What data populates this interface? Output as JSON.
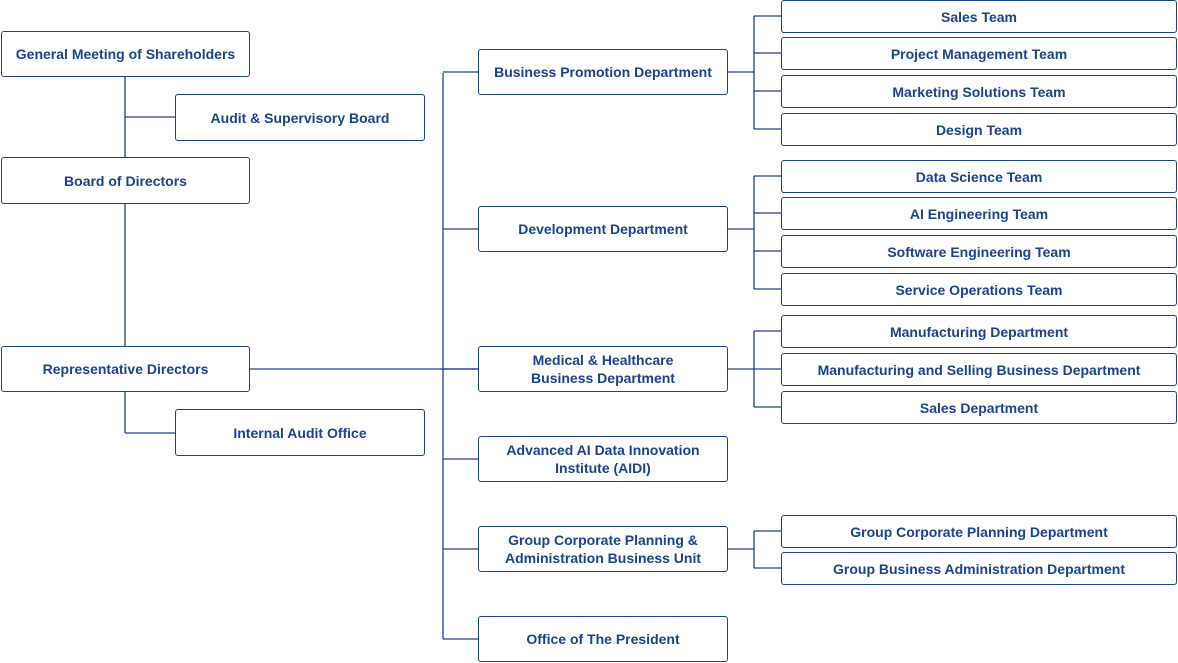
{
  "colors": {
    "line": "#1a4490",
    "text": "#1a4490"
  },
  "left": {
    "shareholders": "General Meeting of Shareholders",
    "audit_board": "Audit & Supervisory Board",
    "board": "Board of Directors",
    "representative": "Representative Directors",
    "internal_audit": "Internal Audit Office"
  },
  "departments": [
    {
      "label": "Business Promotion Department",
      "teams": [
        "Sales Team",
        "Project Management Team",
        "Marketing Solutions Team",
        "Design Team"
      ]
    },
    {
      "label": "Development Department",
      "teams": [
        "Data Science Team",
        "AI Engineering Team",
        "Software Engineering Team",
        "Service Operations Team"
      ]
    },
    {
      "label": "Medical & Healthcare\nBusiness Department",
      "teams": [
        "Manufacturing Department",
        "Manufacturing and Selling Business Department",
        "Sales Department"
      ]
    },
    {
      "label": "Advanced AI Data Innovation\nInstitute (AIDI)",
      "teams": []
    },
    {
      "label": "Group Corporate Planning &\nAdministration Business Unit",
      "teams": [
        "Group Corporate Planning Department",
        "Group Business Administration Department"
      ]
    },
    {
      "label": "Office of The President",
      "teams": []
    }
  ]
}
